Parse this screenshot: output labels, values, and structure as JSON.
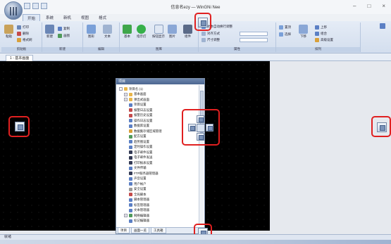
{
  "window": {
    "title": "信息名ezy — WinGNi Nee",
    "controls": [
      "–",
      "□",
      "×"
    ]
  },
  "ribbon": {
    "tabs": [
      "开始",
      "系统",
      "新机",
      "视图",
      "格式"
    ],
    "active_tab": 0,
    "groups": [
      {
        "label": "剪贴板",
        "buttons": [
          "粘贴",
          "打印",
          "删除",
          "格式刷"
        ]
      },
      {
        "label": "新建",
        "buttons": [
          "新建",
          "复制",
          "画图"
        ]
      },
      {
        "label": "编辑",
        "buttons": [
          "图形",
          "文本"
        ]
      },
      {
        "label": "图库",
        "buttons": [
          "基本",
          "指示灯",
          "按钮显示",
          "图片",
          "组件"
        ]
      },
      {
        "label": "属性",
        "buttons": [
          "文本自动换行调整",
          "对齐方式",
          "尺寸调整"
        ]
      },
      {
        "label": "排列",
        "buttons": [
          "置顶",
          "选择",
          "下移",
          "上移",
          "组合",
          "高级设置"
        ]
      }
    ]
  },
  "doc_tab": {
    "label": "1 - 基本画面"
  },
  "panel": {
    "title": "项目",
    "tree": [
      {
        "label": "项目名 (1)",
        "level": 0,
        "toggle": "-",
        "color": "#e8b54a"
      },
      {
        "label": "基本画面",
        "level": 1,
        "toggle": "+",
        "color": "#e8b54a"
      },
      {
        "label": "弹出式画面",
        "level": 1,
        "toggle": "+",
        "color": "#e8b54a"
      },
      {
        "label": "项目设置",
        "level": 1,
        "toggle": "",
        "color": "#5b7fc4"
      },
      {
        "label": "报警日志设置",
        "level": 1,
        "toggle": "",
        "color": "#c44b4b"
      },
      {
        "label": "报警历史设置",
        "level": 1,
        "toggle": "",
        "color": "#c44b4b"
      },
      {
        "label": "操作日志设置",
        "level": 1,
        "toggle": "",
        "color": "#5b7fc4"
      },
      {
        "label": "数据库设置",
        "level": 1,
        "toggle": "",
        "color": "#5b7fc4"
      },
      {
        "label": "数据集存储区域管理",
        "level": 1,
        "toggle": "",
        "color": "#d9a03a"
      },
      {
        "label": "配方设置",
        "level": 1,
        "toggle": "",
        "color": "#4f9a5a"
      },
      {
        "label": "趋势图设置",
        "level": 1,
        "toggle": "",
        "color": "#5b7fc4"
      },
      {
        "label": "定时操作设置",
        "level": 1,
        "toggle": "",
        "color": "#5b7fc4"
      },
      {
        "label": "电子邮件设置",
        "level": 1,
        "toggle": "",
        "color": "#333a55"
      },
      {
        "label": "电子邮件发送",
        "level": 1,
        "toggle": "",
        "color": "#333a55"
      },
      {
        "label": "打印报表设置",
        "level": 1,
        "toggle": "",
        "color": "#333a55"
      },
      {
        "label": "文件传输",
        "level": 1,
        "toggle": "",
        "color": "#5b7fc4"
      },
      {
        "label": "FTP服务器管理器",
        "level": 1,
        "toggle": "",
        "color": "#333a55"
      },
      {
        "label": "声音设置",
        "level": 1,
        "toggle": "",
        "color": "#5b7fc4"
      },
      {
        "label": "用户帐户",
        "level": 1,
        "toggle": "",
        "color": "#5b7fc4"
      },
      {
        "label": "安全设置",
        "level": 1,
        "toggle": "",
        "color": "#999999"
      },
      {
        "label": "全局脚本",
        "level": 1,
        "toggle": "",
        "color": "#c44b4b"
      },
      {
        "label": "脚本管理器",
        "level": 1,
        "toggle": "",
        "color": "#5b7fc4"
      },
      {
        "label": "标签管理器",
        "level": 1,
        "toggle": "",
        "color": "#5b7fc4"
      },
      {
        "label": "文本管理器",
        "level": 1,
        "toggle": "",
        "color": "#5b7fc4"
      },
      {
        "label": "网络编辑器",
        "level": 1,
        "toggle": "+",
        "color": "#4f9a5a"
      },
      {
        "label": "标记编辑器",
        "level": 1,
        "toggle": "",
        "color": "#5b7fc4"
      }
    ],
    "tabs": [
      "项目",
      "画面一览",
      "工具箱"
    ]
  },
  "statusbar": {
    "label": "就绪"
  }
}
